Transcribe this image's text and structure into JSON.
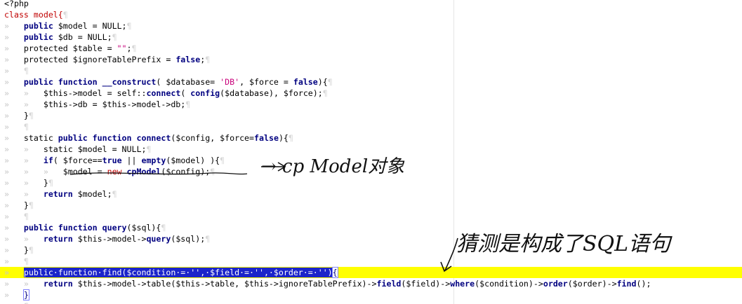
{
  "editor": {
    "lines": [
      {
        "tokens": [
          {
            "t": "<?php",
            "c": "plain"
          }
        ]
      },
      {
        "tokens": [
          {
            "t": "class",
            "c": "red"
          },
          {
            "t": " model{",
            "c": "red"
          },
          {
            "t": "¶",
            "c": "pil"
          }
        ]
      },
      {
        "tokens": [
          {
            "t": "»   ",
            "c": "ws"
          },
          {
            "t": "public",
            "c": "kw"
          },
          {
            "t": " $model = NULL;",
            "c": "plain"
          },
          {
            "t": "¶",
            "c": "pil"
          }
        ]
      },
      {
        "tokens": [
          {
            "t": "»   ",
            "c": "ws"
          },
          {
            "t": "public",
            "c": "kw"
          },
          {
            "t": " $db = NULL;",
            "c": "plain"
          },
          {
            "t": "¶",
            "c": "pil"
          }
        ]
      },
      {
        "tokens": [
          {
            "t": "»   ",
            "c": "ws"
          },
          {
            "t": "protected $table = ",
            "c": "plain"
          },
          {
            "t": "\"\"",
            "c": "str"
          },
          {
            "t": ";",
            "c": "plain"
          },
          {
            "t": "¶",
            "c": "pil"
          }
        ]
      },
      {
        "tokens": [
          {
            "t": "»   ",
            "c": "ws"
          },
          {
            "t": "protected $ignoreTablePrefix = ",
            "c": "plain"
          },
          {
            "t": "false",
            "c": "kw"
          },
          {
            "t": ";",
            "c": "plain"
          },
          {
            "t": "¶",
            "c": "pil"
          }
        ]
      },
      {
        "tokens": [
          {
            "t": "»   ",
            "c": "ws"
          },
          {
            "t": "¶",
            "c": "pil"
          }
        ]
      },
      {
        "tokens": [
          {
            "t": "»   ",
            "c": "ws"
          },
          {
            "t": "public function",
            "c": "kw"
          },
          {
            "t": " ",
            "c": "plain"
          },
          {
            "t": "__construct",
            "c": "fn"
          },
          {
            "t": "( $database= ",
            "c": "plain"
          },
          {
            "t": "'DB'",
            "c": "str"
          },
          {
            "t": ", $force = ",
            "c": "plain"
          },
          {
            "t": "false",
            "c": "kw"
          },
          {
            "t": "){",
            "c": "plain"
          },
          {
            "t": "¶",
            "c": "pil"
          }
        ]
      },
      {
        "tokens": [
          {
            "t": "»   »   ",
            "c": "ws"
          },
          {
            "t": "$this->model = self::",
            "c": "plain"
          },
          {
            "t": "connect",
            "c": "fn"
          },
          {
            "t": "( ",
            "c": "plain"
          },
          {
            "t": "config",
            "c": "fn"
          },
          {
            "t": "($database), $force);",
            "c": "plain"
          },
          {
            "t": "¶",
            "c": "pil"
          }
        ]
      },
      {
        "tokens": [
          {
            "t": "»   »   ",
            "c": "ws"
          },
          {
            "t": "$this->db = $this->model->db;",
            "c": "plain"
          },
          {
            "t": "¶",
            "c": "pil"
          }
        ]
      },
      {
        "tokens": [
          {
            "t": "»   ",
            "c": "ws"
          },
          {
            "t": "}",
            "c": "plain"
          },
          {
            "t": "¶",
            "c": "pil"
          }
        ]
      },
      {
        "tokens": [
          {
            "t": "»   ",
            "c": "ws"
          },
          {
            "t": "¶",
            "c": "pil"
          }
        ]
      },
      {
        "tokens": [
          {
            "t": "»   ",
            "c": "ws"
          },
          {
            "t": "static ",
            "c": "plain"
          },
          {
            "t": "public function",
            "c": "kw"
          },
          {
            "t": " ",
            "c": "plain"
          },
          {
            "t": "connect",
            "c": "fn"
          },
          {
            "t": "($config, $force=",
            "c": "plain"
          },
          {
            "t": "false",
            "c": "kw"
          },
          {
            "t": "){",
            "c": "plain"
          },
          {
            "t": "¶",
            "c": "pil"
          }
        ]
      },
      {
        "tokens": [
          {
            "t": "»   »   ",
            "c": "ws"
          },
          {
            "t": "static $model = NULL;",
            "c": "plain"
          },
          {
            "t": "¶",
            "c": "pil"
          }
        ]
      },
      {
        "tokens": [
          {
            "t": "»   »   ",
            "c": "ws"
          },
          {
            "t": "if",
            "c": "kw"
          },
          {
            "t": "( $force==",
            "c": "plain"
          },
          {
            "t": "true",
            "c": "kw"
          },
          {
            "t": " || ",
            "c": "plain"
          },
          {
            "t": "empty",
            "c": "fn"
          },
          {
            "t": "($model) ){",
            "c": "plain"
          },
          {
            "t": "¶",
            "c": "pil"
          }
        ]
      },
      {
        "tokens": [
          {
            "t": "»   »   »   ",
            "c": "ws"
          },
          {
            "t": "$model = ",
            "c": "plain"
          },
          {
            "t": "new",
            "c": "red"
          },
          {
            "t": " ",
            "c": "plain"
          },
          {
            "t": "cpModel",
            "c": "fn"
          },
          {
            "t": "($config);",
            "c": "plain"
          },
          {
            "t": "¶",
            "c": "pil"
          }
        ]
      },
      {
        "tokens": [
          {
            "t": "»   »   ",
            "c": "ws"
          },
          {
            "t": "}",
            "c": "plain"
          },
          {
            "t": "¶",
            "c": "pil"
          }
        ]
      },
      {
        "tokens": [
          {
            "t": "»   »   ",
            "c": "ws"
          },
          {
            "t": "return",
            "c": "kw"
          },
          {
            "t": " $model;",
            "c": "plain"
          },
          {
            "t": "¶",
            "c": "pil"
          }
        ]
      },
      {
        "tokens": [
          {
            "t": "»   ",
            "c": "ws"
          },
          {
            "t": "}",
            "c": "plain"
          },
          {
            "t": "¶",
            "c": "pil"
          }
        ]
      },
      {
        "tokens": [
          {
            "t": "»   ",
            "c": "ws"
          },
          {
            "t": "¶",
            "c": "pil"
          }
        ]
      },
      {
        "tokens": [
          {
            "t": "»   ",
            "c": "ws"
          },
          {
            "t": "public function",
            "c": "kw"
          },
          {
            "t": " ",
            "c": "plain"
          },
          {
            "t": "query",
            "c": "fn"
          },
          {
            "t": "($sql){",
            "c": "plain"
          },
          {
            "t": "¶",
            "c": "pil"
          }
        ]
      },
      {
        "tokens": [
          {
            "t": "»   »   ",
            "c": "ws"
          },
          {
            "t": "return",
            "c": "kw"
          },
          {
            "t": " $this->model->",
            "c": "plain"
          },
          {
            "t": "query",
            "c": "fn"
          },
          {
            "t": "($sql);",
            "c": "plain"
          },
          {
            "t": "¶",
            "c": "pil"
          }
        ]
      },
      {
        "tokens": [
          {
            "t": "»   ",
            "c": "ws"
          },
          {
            "t": "}",
            "c": "plain"
          },
          {
            "t": "¶",
            "c": "pil"
          }
        ]
      },
      {
        "tokens": [
          {
            "t": "»   ",
            "c": "ws"
          },
          {
            "t": "¶",
            "c": "pil"
          }
        ]
      },
      {
        "highlight": true,
        "tokens": [
          {
            "t": "»   ",
            "c": "ws"
          },
          {
            "t": "public·function·find($condition·=·'',·$field·=·'',·$order·=·'')",
            "c": "sel"
          },
          {
            "t": "{",
            "c": "caret"
          }
        ]
      },
      {
        "tokens": [
          {
            "t": "»   »   ",
            "c": "ws"
          },
          {
            "t": "return",
            "c": "kw"
          },
          {
            "t": " $this->model->table($this->table, $this->ignoreTablePrefix)->",
            "c": "plain"
          },
          {
            "t": "field",
            "c": "fn"
          },
          {
            "t": "($field)->",
            "c": "plain"
          },
          {
            "t": "where",
            "c": "fn"
          },
          {
            "t": "($condition)->",
            "c": "plain"
          },
          {
            "t": "order",
            "c": "fn"
          },
          {
            "t": "($order)->",
            "c": "plain"
          },
          {
            "t": "find",
            "c": "fn"
          },
          {
            "t": "();",
            "c": "plain"
          }
        ]
      },
      {
        "tokens": [
          {
            "t": "»   ",
            "c": "ws"
          },
          {
            "t": "}",
            "c": "caret"
          }
        ]
      },
      {
        "tokens": [
          {
            "t": "»   ",
            "c": "ws"
          },
          {
            "t": "¶",
            "c": "pil"
          }
        ]
      }
    ]
  },
  "annotations": {
    "note1": "→ cp Model对象",
    "note2": "猜测是构成了SQL语句"
  }
}
